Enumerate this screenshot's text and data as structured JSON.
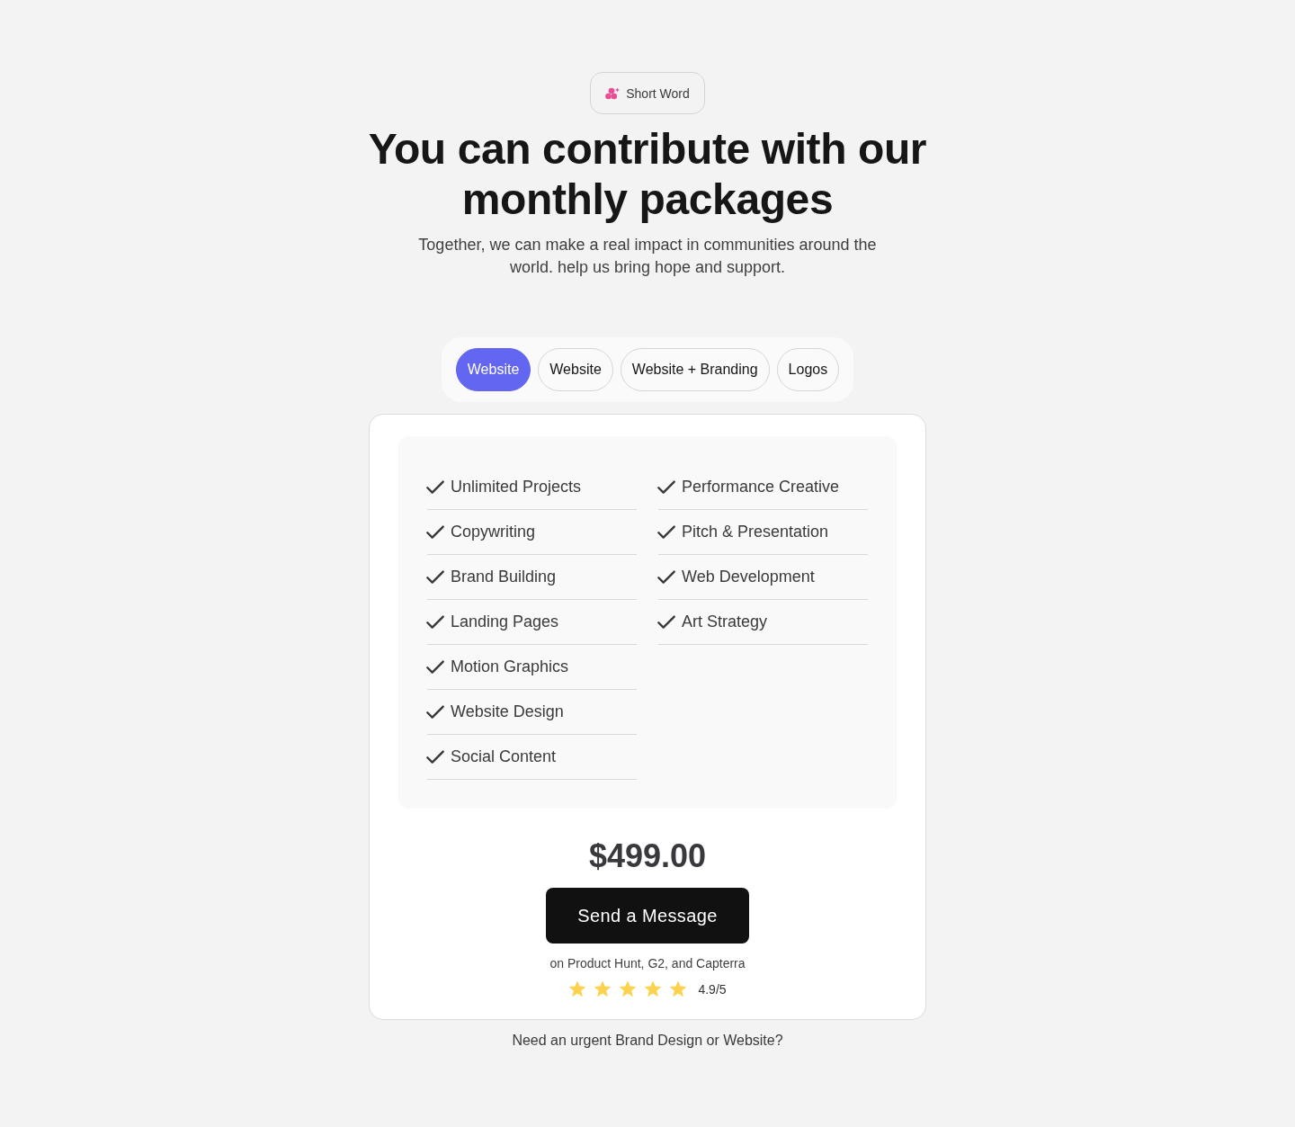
{
  "badge": {
    "label": "Short Word"
  },
  "heading": "You can contribute with our monthly packages",
  "subtitle": "Together, we can make a real impact in communities around the world. help us bring hope and support.",
  "tabs": [
    {
      "label": "Website",
      "selected": true
    },
    {
      "label": "Website",
      "selected": false
    },
    {
      "label": "Website + Branding",
      "selected": false
    },
    {
      "label": "Logos",
      "selected": false
    }
  ],
  "feature_columns": [
    {
      "items": [
        "Unlimited Projects",
        "Copywriting",
        "Brand Building",
        "Landing Pages",
        "Motion Graphics",
        "Website Design",
        "Social Content"
      ]
    },
    {
      "items": [
        "Performance Creative",
        "Pitch & Presentation",
        "Web Development",
        "Art Strategy"
      ]
    }
  ],
  "price": "$499.00",
  "cta_button": "Send a Message",
  "rating": {
    "caption": "on Product Hunt, G2, and Capterra",
    "stars": 5,
    "score": "4.9/5"
  },
  "footer_note": "Need an urgent Brand Design or Website?"
}
